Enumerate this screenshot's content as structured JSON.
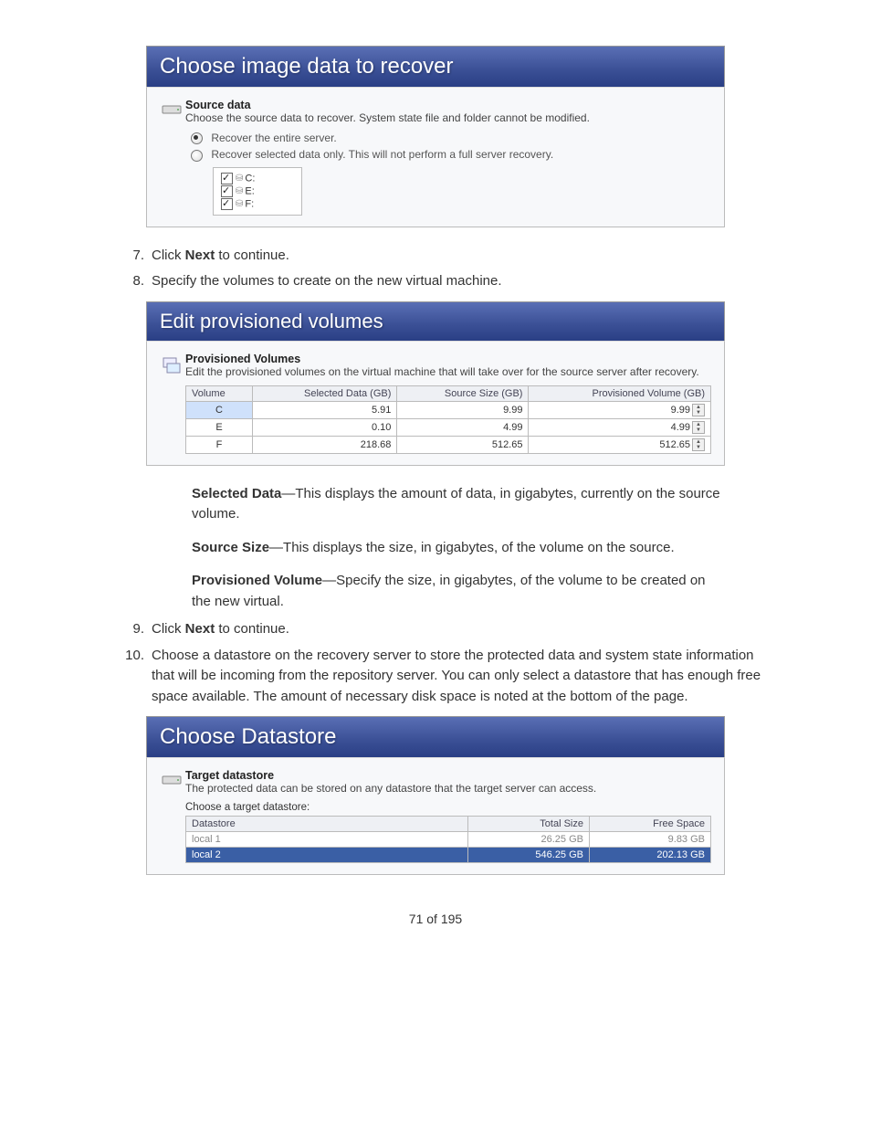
{
  "screenshot1": {
    "banner": "Choose image data to recover",
    "section_title": "Source data",
    "section_sub": "Choose the source data to recover.  System state file and folder cannot be modified.",
    "radio1": "Recover the entire server.",
    "radio2": "Recover selected data only.  This will not perform a full server recovery.",
    "tree": [
      "C:",
      "E:",
      "F:"
    ]
  },
  "steps": {
    "s7_click": "Click ",
    "s7_bold": "Next",
    "s7_rest": " to continue.",
    "s8": "Specify the volumes to create on the new virtual machine.",
    "s9_click": "Click ",
    "s9_bold": "Next",
    "s9_rest": " to continue.",
    "s10": "Choose a datastore on the recovery server to store the protected data and system state information that will be incoming from the repository server. You can only select a datastore that has enough free space available. The amount of necessary disk space is noted at the bottom of the page."
  },
  "screenshot2": {
    "banner": "Edit provisioned volumes",
    "section_title": "Provisioned Volumes",
    "section_sub": "Edit the provisioned volumes on the virtual machine that will take over for the source server after recovery.",
    "headers": {
      "vol": "Volume",
      "sel": "Selected Data (GB)",
      "src": "Source Size (GB)",
      "prov": "Provisioned Volume (GB)"
    },
    "chart_data": {
      "type": "table",
      "rows": [
        {
          "vol": "C",
          "selected": "5.91",
          "source": "9.99",
          "prov": "9.99"
        },
        {
          "vol": "E",
          "selected": "0.10",
          "source": "4.99",
          "prov": "4.99"
        },
        {
          "vol": "F",
          "selected": "218.68",
          "source": "512.65",
          "prov": "512.65"
        }
      ]
    }
  },
  "definitions": {
    "d1_b": "Selected Data",
    "d1": "—This displays the amount of data, in gigabytes, currently on the source volume.",
    "d2_b": "Source Size",
    "d2": "—This displays the size, in gigabytes, of the volume on the source.",
    "d3_b": "Provisioned Volume",
    "d3": "—Specify the size, in gigabytes, of the volume to be created on the new virtual."
  },
  "screenshot3": {
    "banner": "Choose Datastore",
    "section_title": "Target datastore",
    "section_sub": "The protected data can be stored on any datastore that the target server can access.",
    "choose_label": "Choose a target datastore:",
    "headers": {
      "ds": "Datastore",
      "tot": "Total Size",
      "free": "Free Space"
    },
    "chart_data": {
      "type": "table",
      "rows": [
        {
          "ds": "local 1",
          "tot": "26.25 GB",
          "free": "9.83 GB"
        },
        {
          "ds": "local 2",
          "tot": "546.25 GB",
          "free": "202.13 GB"
        }
      ]
    }
  },
  "footer": "71 of 195"
}
